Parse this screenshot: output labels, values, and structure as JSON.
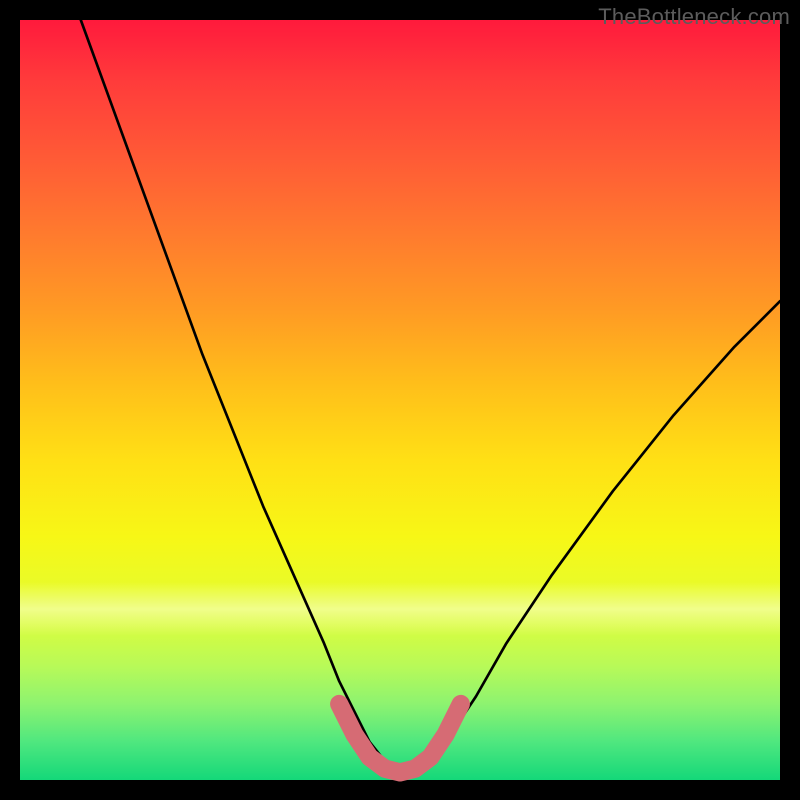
{
  "watermark": "TheBottleneck.com",
  "chart_data": {
    "type": "line",
    "title": "",
    "xlabel": "",
    "ylabel": "",
    "xlim": [
      0,
      100
    ],
    "ylim": [
      0,
      100
    ],
    "grid": false,
    "series": [
      {
        "name": "black-curve",
        "color": "#000000",
        "x": [
          8,
          12,
          16,
          20,
          24,
          28,
          32,
          36,
          40,
          42,
          44,
          46,
          48,
          50,
          52,
          54,
          56,
          60,
          64,
          70,
          78,
          86,
          94,
          100
        ],
        "y": [
          100,
          89,
          78,
          67,
          56,
          46,
          36,
          27,
          18,
          13,
          9,
          5,
          2.5,
          1.5,
          1.5,
          2.5,
          5,
          11,
          18,
          27,
          38,
          48,
          57,
          63
        ]
      },
      {
        "name": "pink-trough",
        "color": "#d66b74",
        "x": [
          42,
          44,
          46,
          48,
          50,
          52,
          54,
          56,
          58
        ],
        "y": [
          10,
          6,
          3,
          1.5,
          1,
          1.5,
          3,
          6,
          10
        ]
      }
    ],
    "legend": false
  }
}
